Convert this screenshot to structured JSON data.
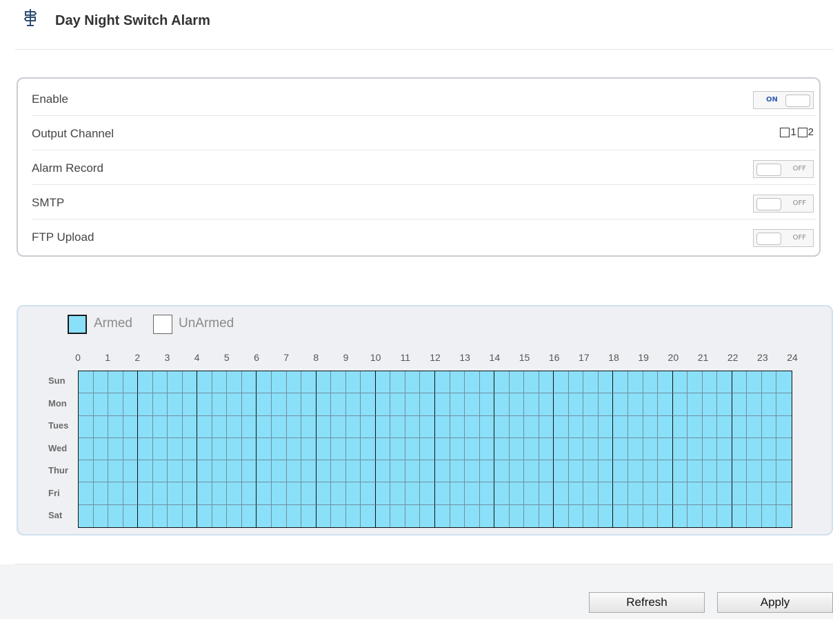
{
  "header": {
    "title": "Day Night Switch Alarm",
    "icon": "signpost-icon"
  },
  "settings": {
    "enable": {
      "label": "Enable",
      "toggle_text": "ON",
      "state": "on"
    },
    "output_channel": {
      "label": "Output Channel",
      "channels": [
        "1",
        "2"
      ],
      "checked": [
        false,
        false
      ]
    },
    "alarm_record": {
      "label": "Alarm Record",
      "toggle_text": "OFF",
      "state": "off"
    },
    "smtp": {
      "label": "SMTP",
      "toggle_text": "OFF",
      "state": "off"
    },
    "ftp_upload": {
      "label": "FTP Upload",
      "toggle_text": "OFF",
      "state": "off"
    }
  },
  "schedule": {
    "legend": {
      "armed": "Armed",
      "unarmed": "UnArmed"
    },
    "hours": [
      "0",
      "1",
      "2",
      "3",
      "4",
      "5",
      "6",
      "7",
      "8",
      "9",
      "10",
      "11",
      "12",
      "13",
      "14",
      "15",
      "16",
      "17",
      "18",
      "19",
      "20",
      "21",
      "22",
      "23",
      "24"
    ],
    "days": [
      "Sun",
      "Mon",
      "Tues",
      "Wed",
      "Thur",
      "Fri",
      "Sat"
    ],
    "armed_color": "#8ae0f8",
    "all_armed": true
  },
  "footer": {
    "refresh_label": "Refresh",
    "apply_label": "Apply"
  }
}
